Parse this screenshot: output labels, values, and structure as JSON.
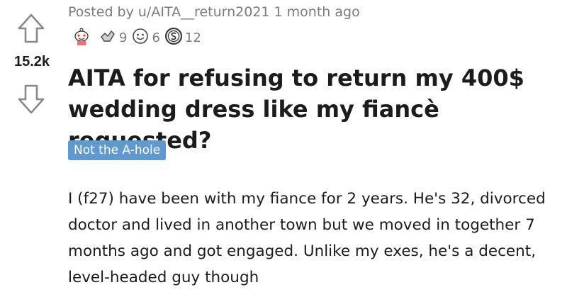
{
  "post": {
    "score": "15.2k",
    "meta": "Posted by u/AITA__return2021 1 month ago",
    "awards": [
      {
        "icon": "reddit-avatar-award-icon",
        "count": ""
      },
      {
        "icon": "helpful-award-icon",
        "count": "9"
      },
      {
        "icon": "wholesome-award-icon",
        "count": "6"
      },
      {
        "icon": "silver-award-icon",
        "count": "12"
      }
    ],
    "title": "AITA for refusing to return my 400$ wedding dress like my fiancè requested?",
    "flair": "Not the A-hole",
    "body": "I (f27) have been with my fiance for 2 years. He's 32, divorced doctor and lived in another town but we moved in together 7 months ago and got engaged. Unlike my exes, he's a decent, level-headed guy though"
  },
  "colors": {
    "flair_bg": "#5f99cf",
    "meta_text": "#787c7e",
    "text": "#1c1c1c"
  }
}
